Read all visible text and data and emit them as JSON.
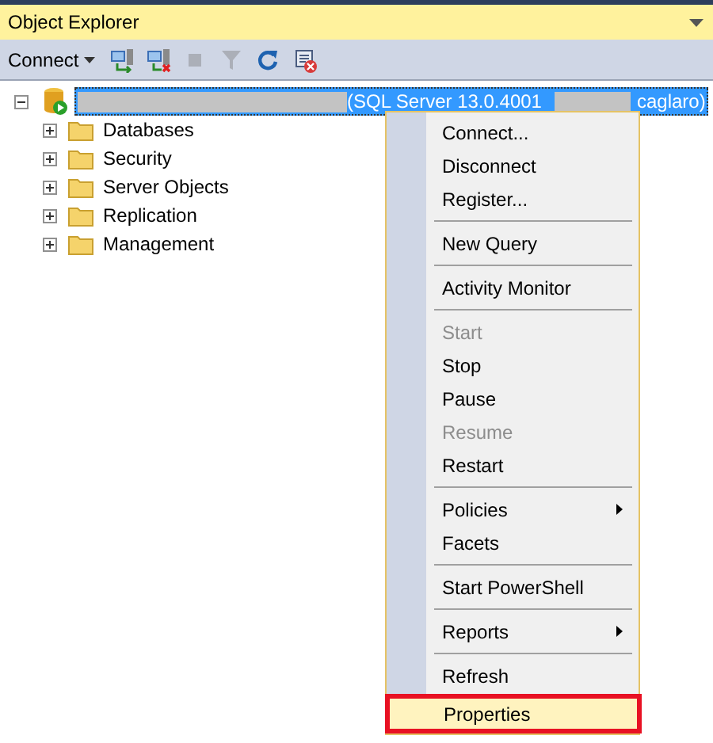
{
  "panel": {
    "title": "Object Explorer"
  },
  "toolbar": {
    "connect_label": "Connect",
    "buttons": [
      {
        "kind": "connect-server",
        "disabled": false
      },
      {
        "kind": "disconnect-server",
        "disabled": false
      },
      {
        "kind": "stop",
        "disabled": true
      },
      {
        "kind": "filter",
        "disabled": true
      },
      {
        "kind": "refresh",
        "disabled": false
      },
      {
        "kind": "script-stop",
        "disabled": false
      }
    ]
  },
  "tree": {
    "server": {
      "label_start": "(SQL Server 13.0.4001",
      "label_end": "caglaro)",
      "expanded": true,
      "selected": true
    },
    "children": [
      {
        "label": "Databases",
        "expanded": false
      },
      {
        "label": "Security",
        "expanded": false
      },
      {
        "label": "Server Objects",
        "expanded": false
      },
      {
        "label": "Replication",
        "expanded": false
      },
      {
        "label": "Management",
        "expanded": false
      }
    ]
  },
  "context_menu": {
    "items": [
      {
        "kind": "item",
        "label": "Connect...",
        "disabled": false,
        "submenu": false,
        "selected": false,
        "outlined": false
      },
      {
        "kind": "item",
        "label": "Disconnect",
        "disabled": false,
        "submenu": false,
        "selected": false,
        "outlined": false
      },
      {
        "kind": "item",
        "label": "Register...",
        "disabled": false,
        "submenu": false,
        "selected": false,
        "outlined": false
      },
      {
        "kind": "separator"
      },
      {
        "kind": "item",
        "label": "New Query",
        "disabled": false,
        "submenu": false,
        "selected": false,
        "outlined": false
      },
      {
        "kind": "separator"
      },
      {
        "kind": "item",
        "label": "Activity Monitor",
        "disabled": false,
        "submenu": false,
        "selected": false,
        "outlined": false
      },
      {
        "kind": "separator"
      },
      {
        "kind": "item",
        "label": "Start",
        "disabled": true,
        "submenu": false,
        "selected": false,
        "outlined": false
      },
      {
        "kind": "item",
        "label": "Stop",
        "disabled": false,
        "submenu": false,
        "selected": false,
        "outlined": false
      },
      {
        "kind": "item",
        "label": "Pause",
        "disabled": false,
        "submenu": false,
        "selected": false,
        "outlined": false
      },
      {
        "kind": "item",
        "label": "Resume",
        "disabled": true,
        "submenu": false,
        "selected": false,
        "outlined": false
      },
      {
        "kind": "item",
        "label": "Restart",
        "disabled": false,
        "submenu": false,
        "selected": false,
        "outlined": false
      },
      {
        "kind": "separator"
      },
      {
        "kind": "item",
        "label": "Policies",
        "disabled": false,
        "submenu": true,
        "selected": false,
        "outlined": false
      },
      {
        "kind": "item",
        "label": "Facets",
        "disabled": false,
        "submenu": false,
        "selected": false,
        "outlined": false
      },
      {
        "kind": "separator"
      },
      {
        "kind": "item",
        "label": "Start PowerShell",
        "disabled": false,
        "submenu": false,
        "selected": false,
        "outlined": false
      },
      {
        "kind": "separator"
      },
      {
        "kind": "item",
        "label": "Reports",
        "disabled": false,
        "submenu": true,
        "selected": false,
        "outlined": false
      },
      {
        "kind": "separator"
      },
      {
        "kind": "item",
        "label": "Refresh",
        "disabled": false,
        "submenu": false,
        "selected": false,
        "outlined": false
      },
      {
        "kind": "item",
        "label": "Properties",
        "disabled": false,
        "submenu": false,
        "selected": true,
        "outlined": true
      }
    ]
  }
}
